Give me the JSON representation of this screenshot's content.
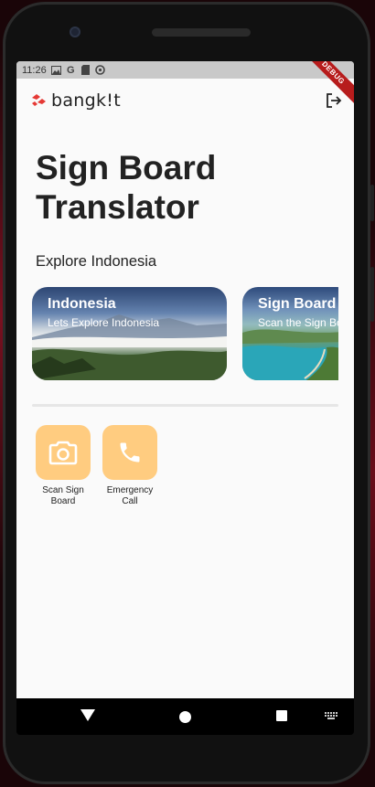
{
  "status_bar": {
    "time": "11:26",
    "debug_banner": "DEBUG"
  },
  "app_bar": {
    "logo_text": "bangk!t"
  },
  "page": {
    "title": "Sign Board Translator",
    "subtitle": "Explore Indonesia"
  },
  "carousel": [
    {
      "title": "Indonesia",
      "subtitle": "Lets Explore Indonesia"
    },
    {
      "title": "Sign Board",
      "subtitle": "Scan the Sign Board"
    }
  ],
  "actions": [
    {
      "label": "Scan Sign Board",
      "icon": "camera-icon"
    },
    {
      "label": "Emergency Call",
      "icon": "phone-icon"
    }
  ],
  "colors": {
    "accent": "#ffcc80",
    "logo_red": "#e53935",
    "status_bar": "#c9c9c9"
  }
}
